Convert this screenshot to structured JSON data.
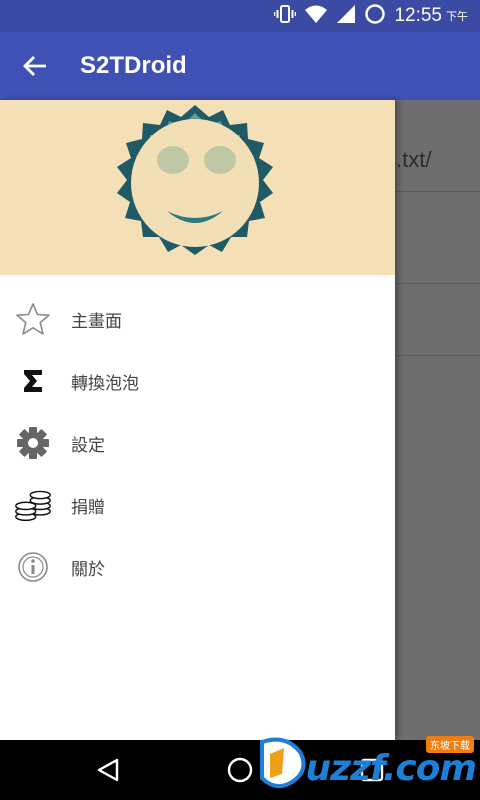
{
  "status_bar": {
    "time": "12:55",
    "ampm": "下午",
    "icons": [
      "vibrate-icon",
      "wifi-icon",
      "signal-icon",
      "sync-icon"
    ]
  },
  "app_bar": {
    "title": "S2TDroid",
    "back_icon": "arrow-back-icon"
  },
  "content": {
    "row1_text": ".txt/"
  },
  "drawer": {
    "menu": [
      {
        "label": "主畫面",
        "icon": "star-outline-icon"
      },
      {
        "label": "轉換泡泡",
        "icon": "sigma-icon"
      },
      {
        "label": "設定",
        "icon": "gear-icon"
      },
      {
        "label": "捐贈",
        "icon": "coins-icon"
      },
      {
        "label": "關於",
        "icon": "info-icon"
      }
    ]
  },
  "nav_bar": {
    "buttons": [
      "back-triangle-icon",
      "home-circle-icon",
      "recents-square-icon"
    ]
  },
  "watermark": {
    "text": "uzzf.com",
    "badge": "东坡下载"
  },
  "colors": {
    "status_bar": "#3b4aa3",
    "app_bar": "#3f51b5",
    "header_bg": "#f4dfb6",
    "sun_teal_dark": "#1f5a66",
    "sun_teal_light": "#5f9a95",
    "scrim": "#6e6e6e"
  }
}
